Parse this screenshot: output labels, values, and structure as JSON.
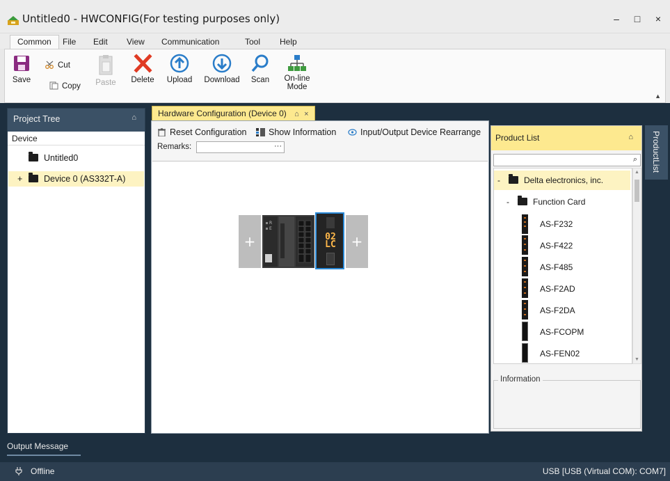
{
  "window": {
    "title": "Untitled0 - HWCONFIG(For testing purposes only)",
    "minimize_glyph": "–",
    "maximize_glyph": "□",
    "close_glyph": "×"
  },
  "menu": {
    "tabs": [
      "Common",
      "File",
      "Edit",
      "View",
      "Communication",
      "Tool",
      "Help"
    ],
    "active": "Common"
  },
  "ribbon": {
    "save": "Save",
    "cut": "Cut",
    "copy": "Copy",
    "paste": "Paste",
    "delete": "Delete",
    "upload": "Upload",
    "download": "Download",
    "scan": "Scan",
    "online_mode_line1": "On-line",
    "online_mode_line2": "Mode",
    "collapse_glyph": "▲"
  },
  "project_tree": {
    "title": "Project Tree",
    "pin_glyph": "⌂",
    "device_header": "Device",
    "items": [
      {
        "label": "Untitled0",
        "expander": ""
      },
      {
        "label": "Device 0 (AS332T-A)",
        "expander": "+"
      }
    ]
  },
  "document": {
    "tab_label": "Hardware Configuration (Device 0)",
    "tab_pin": "⌂",
    "tab_close": "×",
    "toolbar": {
      "reset": "Reset Configuration",
      "show_info": "Show Information",
      "rearrange": "Input/Output Device Rearrange"
    },
    "remarks_label": "Remarks:",
    "remarks_value": "",
    "remarks_button": "···",
    "module_label_line1": "02",
    "module_label_line2": "LC",
    "slot_plus": "+"
  },
  "product_list": {
    "title": "Product List",
    "pin_glyph": "⌂",
    "search_value": "",
    "search_icon_glyph": "⌕",
    "vendor": {
      "label": "Delta electronics, inc.",
      "expander": "-"
    },
    "category": {
      "label": "Function Card",
      "expander": "-"
    },
    "cards": [
      "AS-F232",
      "AS-F422",
      "AS-F485",
      "AS-F2AD",
      "AS-F2DA",
      "AS-FCOPM",
      "AS-FEN02"
    ],
    "info_legend": "Information"
  },
  "side_tab": {
    "label": "ProductList"
  },
  "output": {
    "label": "Output Message"
  },
  "status": {
    "left": "Offline",
    "right": "USB [USB (Virtual COM): COM7]"
  },
  "colors": {
    "dark_background": "#1d2f3f",
    "panel_header": "#3b5166",
    "active_tab": "#fde98f",
    "selection": "#fdf3c2",
    "statusbar": "#2c3e50",
    "delete_red": "#e03b24",
    "accent_blue": "#2a7dc9"
  }
}
